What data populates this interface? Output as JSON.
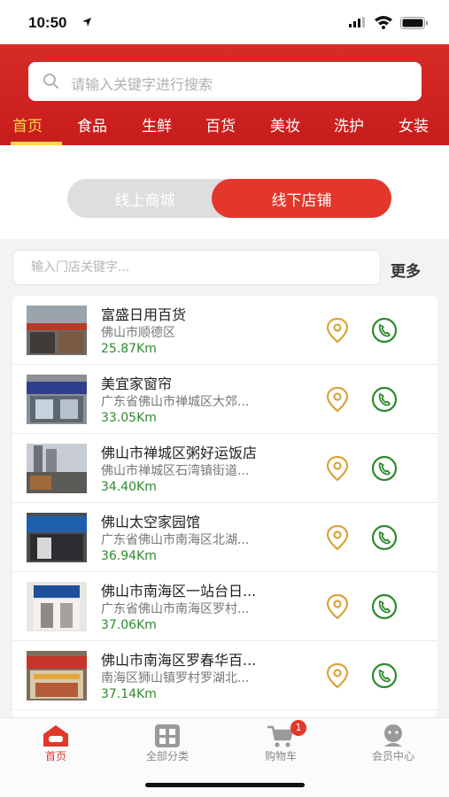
{
  "status_bar": {
    "time": "10:50"
  },
  "search": {
    "placeholder": "请输入关键字进行搜索"
  },
  "categories": [
    "首页",
    "食品",
    "生鲜",
    "百货",
    "美妆",
    "洗护",
    "女装"
  ],
  "toggle": {
    "online": "线上商城",
    "offline": "线下店铺"
  },
  "store_search": {
    "placeholder": "输入门店关键字...",
    "more": "更多"
  },
  "stores": [
    {
      "name": "富盛日用百货",
      "address": "佛山市顺德区",
      "distance": "25.87Km"
    },
    {
      "name": "美宜家窗帘",
      "address": "广东省佛山市禅城区大郊...",
      "distance": "33.05Km"
    },
    {
      "name": "佛山市禅城区粥好运饭店",
      "address": "佛山市禅城区石湾镇街道...",
      "distance": "34.40Km"
    },
    {
      "name": "佛山太空家园馆",
      "address": "广东省佛山市南海区北湖...",
      "distance": "36.94Km"
    },
    {
      "name": "佛山市南海区一站台日...",
      "address": "广东省佛山市南海区罗村...",
      "distance": "37.06Km"
    },
    {
      "name": "佛山市南海区罗春华百...",
      "address": "南海区狮山镇罗村罗湖北...",
      "distance": "37.14Km"
    }
  ],
  "tabbar": {
    "home": "首页",
    "categories": "全部分类",
    "cart": "购物车",
    "cart_badge": "1",
    "member": "会员中心"
  },
  "colors": {
    "brand_red": "#e3372c",
    "active_tab": "#ffd84a",
    "distance_green": "#2f8a2f",
    "pin_gold": "#d9a43a"
  }
}
